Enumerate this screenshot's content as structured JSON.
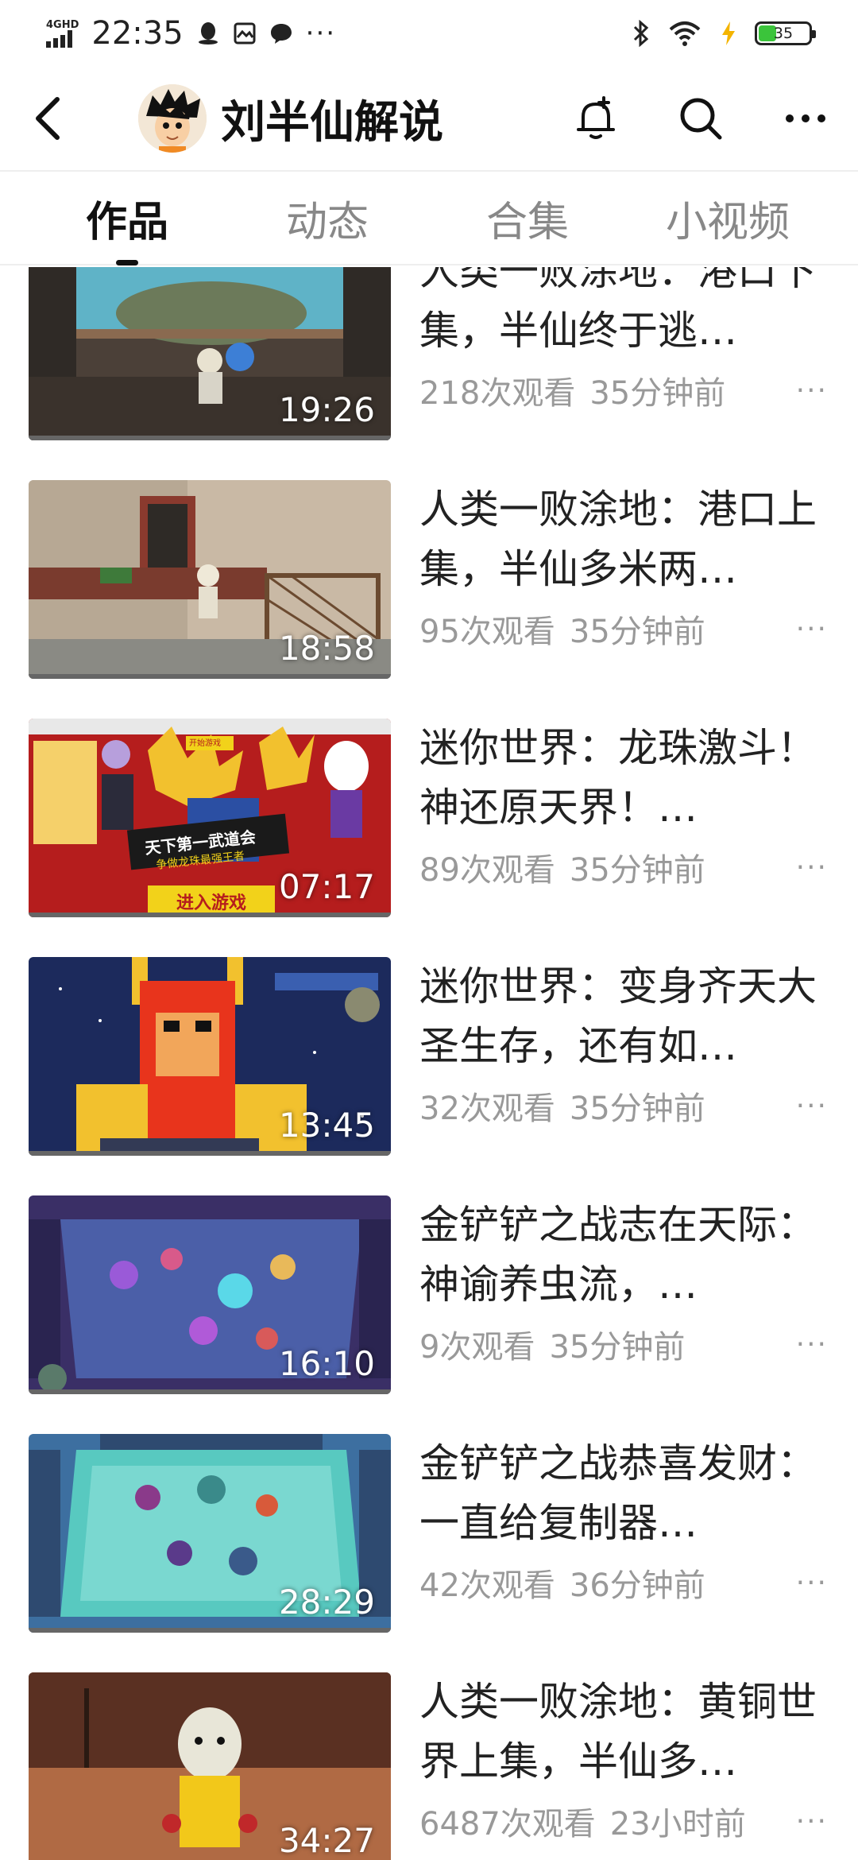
{
  "status_bar": {
    "network": "4GHD",
    "time": "22:35",
    "battery_level": "35",
    "battery_fraction": 0.35,
    "notification_icons": [
      "qq-icon",
      "photo-icon",
      "message-icon"
    ],
    "dots": "···"
  },
  "header": {
    "channel_name": "刘半仙解说"
  },
  "tabs": [
    {
      "label": "作品",
      "active": true
    },
    {
      "label": "动态",
      "active": false
    },
    {
      "label": "合集",
      "active": false
    },
    {
      "label": "小视频",
      "active": false
    }
  ],
  "videos": [
    {
      "title": "人类一败涂地：港口下集，半仙终于逃…",
      "duration": "19:26",
      "views": "218次观看",
      "time": "35分钟前",
      "more": "···"
    },
    {
      "title": "人类一败涂地：港口上集，半仙多米两…",
      "duration": "18:58",
      "views": "95次观看",
      "time": "35分钟前",
      "more": "···"
    },
    {
      "title": "迷你世界：龙珠激斗！神还原天界！…",
      "duration": "07:17",
      "views": "89次观看",
      "time": "35分钟前",
      "more": "···",
      "thumb_text": [
        "开始游戏",
        "天下第一武道会",
        "争做龙珠最强王者",
        "进入游戏"
      ]
    },
    {
      "title": "迷你世界：变身齐天大圣生存，还有如…",
      "duration": "13:45",
      "views": "32次观看",
      "time": "35分钟前",
      "more": "···"
    },
    {
      "title": "金铲铲之战志在天际：神谕养虫流，…",
      "duration": "16:10",
      "views": "9次观看",
      "time": "35分钟前",
      "more": "···"
    },
    {
      "title": "金铲铲之战恭喜发财：一直给复制器…",
      "duration": "28:29",
      "views": "42次观看",
      "time": "36分钟前",
      "more": "···"
    },
    {
      "title": "人类一败涂地：黄铜世界上集，半仙多…",
      "duration": "34:27",
      "views": "6487次观看",
      "time": "23小时前",
      "more": "···"
    }
  ]
}
